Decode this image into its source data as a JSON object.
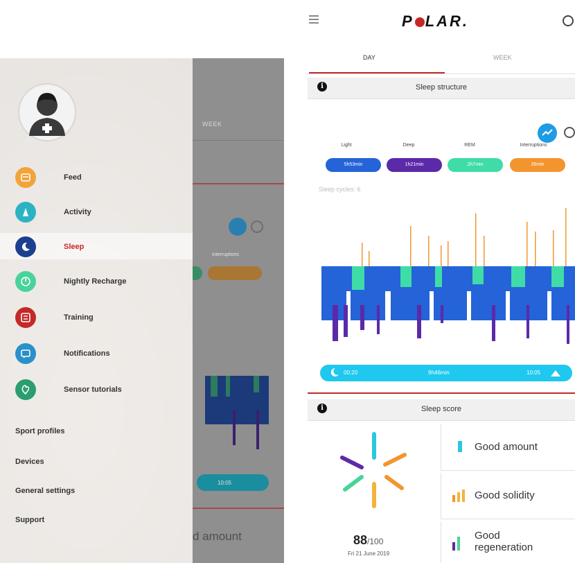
{
  "left_screen": {
    "menu": [
      {
        "label": "Feed",
        "icon": "feed-icon",
        "color": "#f2a33a"
      },
      {
        "label": "Activity",
        "icon": "activity-icon",
        "color": "#2bb3c4"
      },
      {
        "label": "Sleep",
        "icon": "moon-icon",
        "color": "#1d3f8f",
        "active": true
      },
      {
        "label": "Nightly Recharge",
        "icon": "recharge-icon",
        "color": "#49d39a"
      },
      {
        "label": "Training",
        "icon": "training-icon",
        "color": "#c62828"
      },
      {
        "label": "Notifications",
        "icon": "notification-icon",
        "color": "#2a90c8"
      },
      {
        "label": "Sensor tutorials",
        "icon": "sensor-icon",
        "color": "#2a9e6e"
      }
    ],
    "sub_menu": [
      "Sport profiles",
      "Devices",
      "General settings",
      "Support"
    ],
    "behind_week_label": "WEEK",
    "behind_interruptions": "Interruptions",
    "behind_time_end": "10:05",
    "behind_amount": "d amount"
  },
  "right_screen": {
    "logo": {
      "part1": "P",
      "part2": "LAR."
    },
    "tabs": {
      "day": "DAY",
      "week": "WEEK"
    },
    "sleep_structure": {
      "title": "Sleep structure",
      "legend": [
        {
          "label": "Light",
          "value": "5h53min",
          "color": "#2563d8"
        },
        {
          "label": "Deep",
          "value": "1h21min",
          "color": "#5b2aa8"
        },
        {
          "label": "REM",
          "value": "2h7min",
          "color": "#3fdca8"
        },
        {
          "label": "Interruptions",
          "value": "26min",
          "color": "#f3952e"
        }
      ],
      "cycles": "Sleep cycles: 6",
      "start_time": "00:20",
      "duration": "9h46min",
      "end_time": "10:05"
    },
    "sleep_score": {
      "title": "Sleep score",
      "score": "88",
      "score_max": "/100",
      "date": "Fri 21 June 2019",
      "cards": [
        "Good amount",
        "Good solidity",
        "Good regeneration"
      ]
    },
    "colors": {
      "accent": "#c62828",
      "toggle_blue": "#1e9be6",
      "time_bar": "#1ec8ee"
    }
  }
}
